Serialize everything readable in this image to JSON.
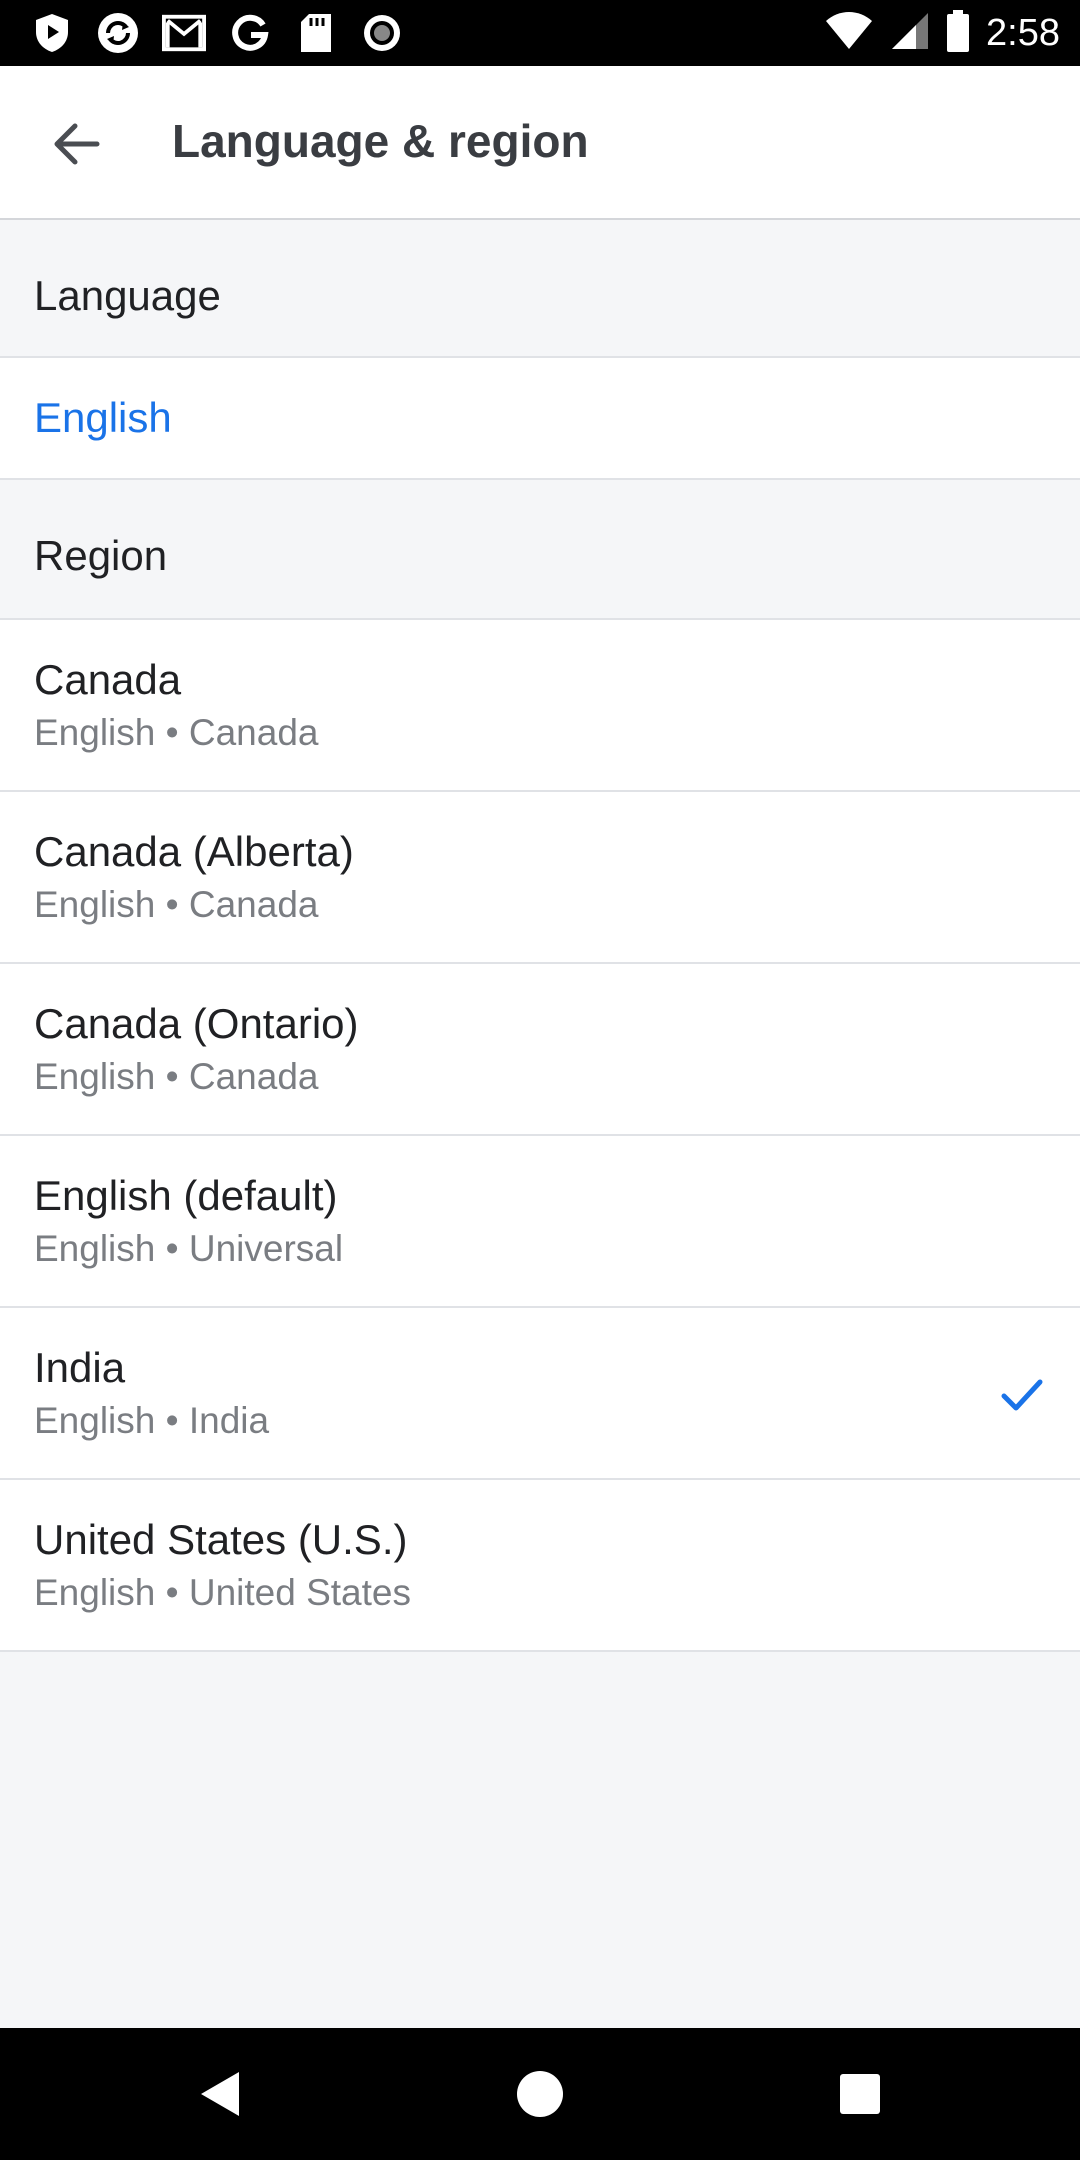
{
  "status_bar": {
    "time": "2:58",
    "left_icons": [
      "shield-icon",
      "sync-icon",
      "gmail-icon",
      "google-icon",
      "sd-card-icon",
      "record-icon"
    ],
    "right_icons": [
      "wifi-icon",
      "signal-icon",
      "battery-icon"
    ]
  },
  "app_bar": {
    "title": "Language & region",
    "back_icon": "arrow-back-icon"
  },
  "language_section": {
    "header": "Language",
    "selected": "English"
  },
  "region_section": {
    "header": "Region",
    "items": [
      {
        "name": "Canada",
        "sub": "English • Canada",
        "selected": false
      },
      {
        "name": "Canada (Alberta)",
        "sub": "English • Canada",
        "selected": false
      },
      {
        "name": "Canada (Ontario)",
        "sub": "English • Canada",
        "selected": false
      },
      {
        "name": "English (default)",
        "sub": "English • Universal",
        "selected": false
      },
      {
        "name": "India",
        "sub": "English • India",
        "selected": true
      },
      {
        "name": "United States (U.S.)",
        "sub": "English • United States",
        "selected": false
      }
    ]
  },
  "nav_bar": {
    "icons": [
      "back-triangle-icon",
      "home-circle-icon",
      "recents-square-icon"
    ]
  },
  "colors": {
    "accent": "#1a73e8",
    "background": "#f5f6f8",
    "surface": "#ffffff",
    "divider": "#e0e2e6",
    "secondary_text": "#7a7d82"
  }
}
